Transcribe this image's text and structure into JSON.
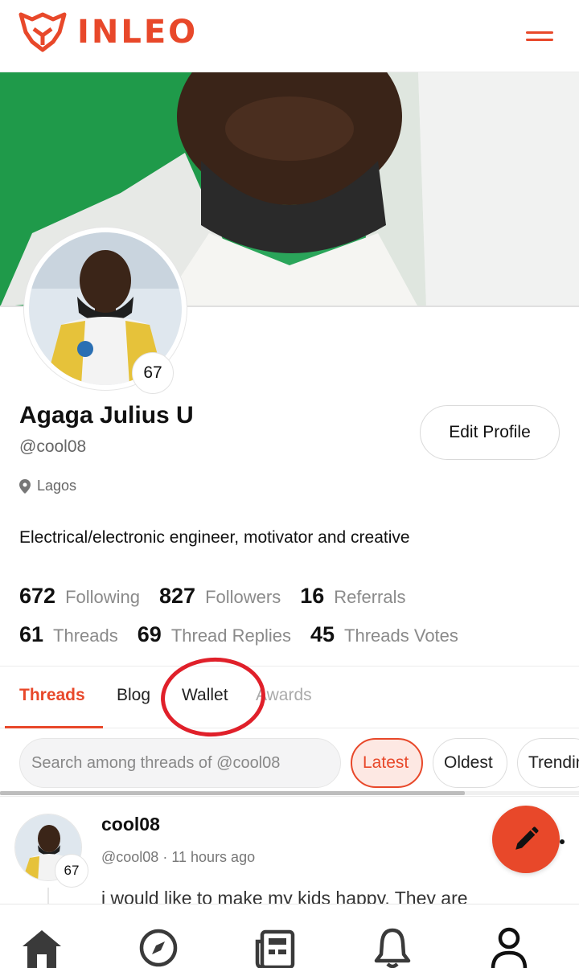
{
  "app": {
    "brand": "INLEO",
    "accent_color": "#e8482a"
  },
  "header": {
    "logo_icon": "lion-logo-icon",
    "menu_icon": "hamburger-menu-icon"
  },
  "profile": {
    "display_name": "Agaga Julius U",
    "handle": "@cool08",
    "reputation": "67",
    "location": "Lagos",
    "bio": "Electrical/electronic engineer, motivator and creative",
    "edit_label": "Edit Profile"
  },
  "stats": {
    "row1": [
      {
        "value": "672",
        "label": "Following"
      },
      {
        "value": "827",
        "label": "Followers"
      },
      {
        "value": "16",
        "label": "Referrals"
      }
    ],
    "row2": [
      {
        "value": "61",
        "label": "Threads"
      },
      {
        "value": "69",
        "label": "Thread Replies"
      },
      {
        "value": "45",
        "label": "Threads Votes"
      }
    ]
  },
  "tabs": {
    "items": [
      {
        "label": "Threads",
        "active": true
      },
      {
        "label": "Blog",
        "active": false
      },
      {
        "label": "Wallet",
        "active": false
      },
      {
        "label": "Awards",
        "active": false
      }
    ]
  },
  "search": {
    "placeholder": "Search among threads of @cool08"
  },
  "filters": [
    {
      "label": "Latest",
      "active": true
    },
    {
      "label": "Oldest",
      "active": false
    },
    {
      "label": "Trending",
      "active": false
    }
  ],
  "thread": {
    "author": "cool08",
    "handle": "@cool08",
    "time": "11 hours ago",
    "reputation": "67",
    "text": "i would like to make my kids happy. They are"
  },
  "fab": {
    "icon": "pencil-icon"
  },
  "bottom_nav": [
    {
      "icon": "home-icon"
    },
    {
      "icon": "compass-icon"
    },
    {
      "icon": "newspaper-icon"
    },
    {
      "icon": "bell-icon"
    },
    {
      "icon": "user-icon"
    }
  ]
}
